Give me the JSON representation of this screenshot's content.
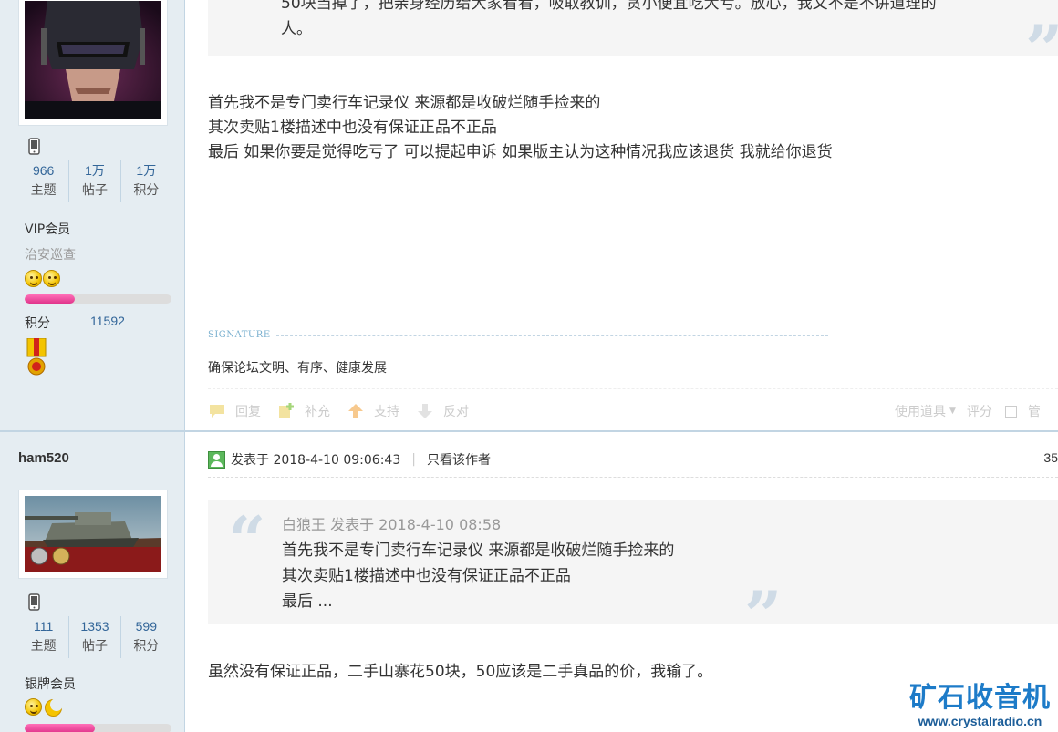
{
  "post1": {
    "author": {
      "stats": [
        {
          "value": "966",
          "label": "主题"
        },
        {
          "value": "1万",
          "label": "帖子"
        },
        {
          "value": "1万",
          "label": "积分"
        }
      ],
      "group": "VIP会员",
      "sub_group": "治安巡查",
      "level_progress": 0.34,
      "credit_label": "积分",
      "credit_value": "11592"
    },
    "quote_lines": [
      "50块当掉了，把亲身经历给大家看看，吸取教训，贪小便宜吃大亏。放心，我又不是不讲道理的",
      "人。"
    ],
    "body_lines": [
      "首先我不是专门卖行车记录仪  来源都是收破烂随手捡来的",
      "其次卖贴1楼描述中也没有保证正品不正品",
      "最后  如果你要是觉得吃亏了  可以提起申诉  如果版主认为这种情况我应该退货  我就给你退货"
    ],
    "signature_label": "SIGNATURE",
    "signature_text": "确保论坛文明、有序、健康发展",
    "actions": {
      "reply": "回复",
      "supplement": "补充",
      "support": "支持",
      "oppose": "反对",
      "use_tool": "使用道具",
      "rate": "评分",
      "manage": "管"
    }
  },
  "post2": {
    "author": {
      "name": "ham520",
      "stats": [
        {
          "value": "111",
          "label": "主题"
        },
        {
          "value": "1353",
          "label": "帖子"
        },
        {
          "value": "599",
          "label": "积分"
        }
      ],
      "group": "银牌会员",
      "level_progress": 0.48
    },
    "meta": {
      "posted": "发表于 2018-4-10 09:06:43",
      "only_author": "只看该作者",
      "floor": "35"
    },
    "quote": {
      "header": "白狼王 发表于 2018-4-10 08:58",
      "lines": [
        "首先我不是专门卖行车记录仪  来源都是收破烂随手捡来的",
        "其次卖贴1楼描述中也没有保证正品不正品",
        "最后  ..."
      ]
    },
    "body": "虽然没有保证正品，二手山寨花50块，50应该是二手真品的价，我输了。"
  },
  "watermark": {
    "title": "矿石收音机",
    "url": "www.crystalradio.cn"
  },
  "colors": {
    "sidebar_bg": "#e5edf2",
    "link_blue": "#336699",
    "progress_pink": "#e0348b",
    "watermark_blue": "#1d7bc8"
  }
}
